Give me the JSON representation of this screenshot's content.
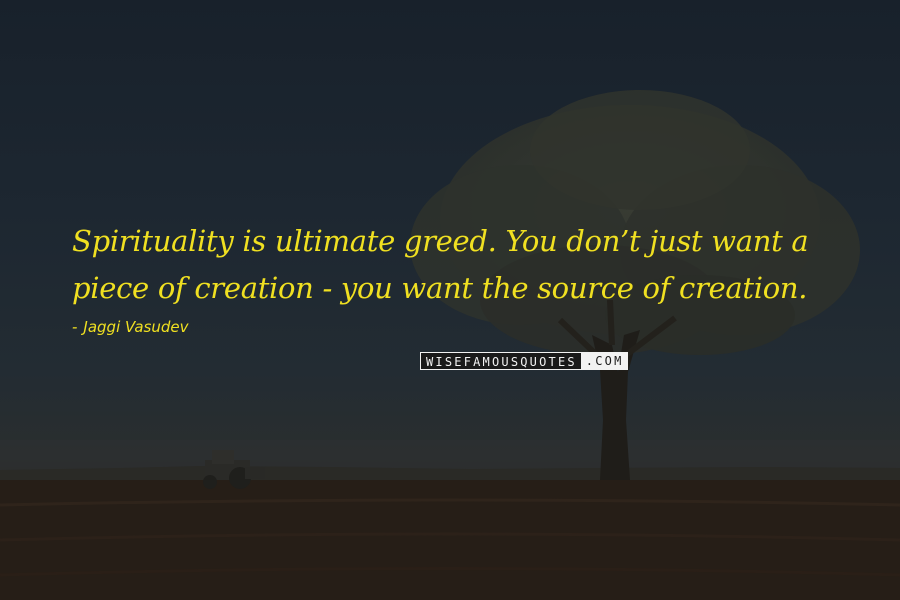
{
  "quote": {
    "text": "Spirituality is ultimate greed. You don’t just want a piece of creation - you want the source of creation.",
    "author_dash": "-",
    "author": "Jaggi Vasudev"
  },
  "watermark": {
    "part_dark": "WISEFAMOUSQUOTES",
    "part_light": ".COM"
  },
  "colors": {
    "text": "#f0e021",
    "sky": "#1c252f",
    "field": "#241d17"
  }
}
